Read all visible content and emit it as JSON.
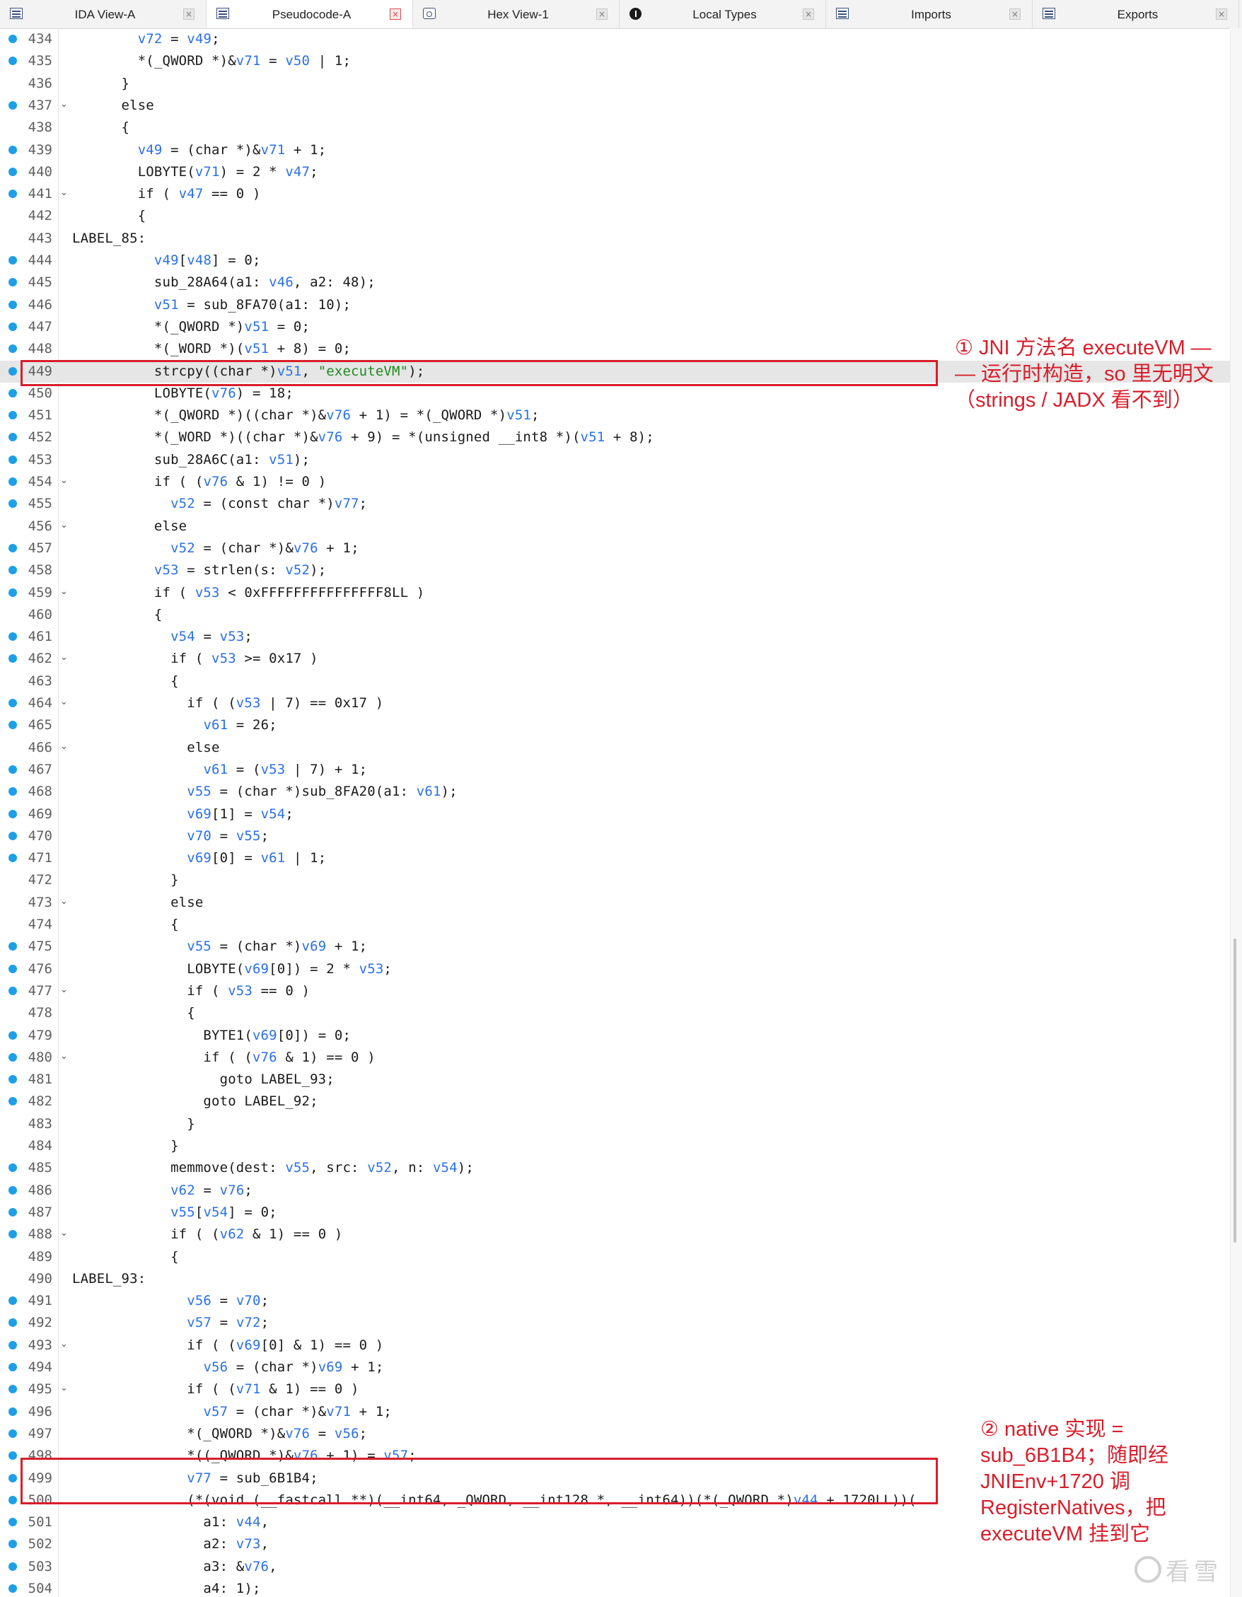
{
  "tabs": [
    {
      "label": "IDA View-A",
      "icon": "listing-icon",
      "close_style": "normal"
    },
    {
      "label": "Pseudocode-A",
      "icon": "pseudocode-icon",
      "close_style": "red",
      "active": true
    },
    {
      "label": "Hex View-1",
      "icon": "hex-view-icon",
      "close_style": "normal"
    },
    {
      "label": "Local Types",
      "icon": "local-types-icon",
      "close_style": "normal"
    },
    {
      "label": "Imports",
      "icon": "imports-icon",
      "close_style": "normal"
    },
    {
      "label": "Exports",
      "icon": "exports-icon",
      "close_style": "normal"
    }
  ],
  "close_glyph": "×",
  "code_lines": [
    {
      "n": 434,
      "bp": true,
      "fold": false,
      "t": [
        [
          "        "
        ],
        [
          "v72",
          "v"
        ],
        [
          " = "
        ],
        [
          "v49",
          "v"
        ],
        [
          ";"
        ]
      ]
    },
    {
      "n": 435,
      "bp": true,
      "fold": false,
      "t": [
        [
          "        *(_QWORD *)&"
        ],
        [
          "v71",
          "v"
        ],
        [
          " = "
        ],
        [
          "v50",
          "v"
        ],
        [
          " | 1;"
        ]
      ]
    },
    {
      "n": 436,
      "bp": false,
      "fold": false,
      "t": [
        [
          "      }"
        ]
      ]
    },
    {
      "n": 437,
      "bp": true,
      "fold": true,
      "t": [
        [
          "      else"
        ]
      ]
    },
    {
      "n": 438,
      "bp": false,
      "fold": false,
      "t": [
        [
          "      {"
        ]
      ]
    },
    {
      "n": 439,
      "bp": true,
      "fold": false,
      "t": [
        [
          "        "
        ],
        [
          "v49",
          "v"
        ],
        [
          " = (char *)&"
        ],
        [
          "v71",
          "v"
        ],
        [
          " + 1;"
        ]
      ]
    },
    {
      "n": 440,
      "bp": true,
      "fold": false,
      "t": [
        [
          "        LOBYTE("
        ],
        [
          "v71",
          "v"
        ],
        [
          ") = 2 * "
        ],
        [
          "v47",
          "v"
        ],
        [
          ";"
        ]
      ]
    },
    {
      "n": 441,
      "bp": true,
      "fold": true,
      "t": [
        [
          "        if ( "
        ],
        [
          "v47",
          "v"
        ],
        [
          " == 0 )"
        ]
      ]
    },
    {
      "n": 442,
      "bp": false,
      "fold": false,
      "t": [
        [
          "        {"
        ]
      ]
    },
    {
      "n": 443,
      "bp": false,
      "fold": false,
      "t": [
        [
          "LABEL_85:"
        ]
      ]
    },
    {
      "n": 444,
      "bp": true,
      "fold": false,
      "t": [
        [
          "          "
        ],
        [
          "v49",
          "v"
        ],
        [
          "["
        ],
        [
          "v48",
          "v"
        ],
        [
          "] = 0;"
        ]
      ]
    },
    {
      "n": 445,
      "bp": true,
      "fold": false,
      "t": [
        [
          "          sub_28A64(a1: "
        ],
        [
          "v46",
          "v"
        ],
        [
          ", a2: 48);"
        ]
      ]
    },
    {
      "n": 446,
      "bp": true,
      "fold": false,
      "t": [
        [
          "          "
        ],
        [
          "v51",
          "v"
        ],
        [
          " = sub_8FA70(a1: 10);"
        ]
      ]
    },
    {
      "n": 447,
      "bp": true,
      "fold": false,
      "t": [
        [
          "          *(_QWORD *)"
        ],
        [
          "v51",
          "v"
        ],
        [
          " = 0;"
        ]
      ]
    },
    {
      "n": 448,
      "bp": true,
      "fold": false,
      "t": [
        [
          "          *(_WORD *)("
        ],
        [
          "v51",
          "v"
        ],
        [
          " + 8) = 0;"
        ]
      ]
    },
    {
      "n": 449,
      "bp": true,
      "fold": false,
      "hl": true,
      "t": [
        [
          "          strcpy((char *)"
        ],
        [
          "v51",
          "v"
        ],
        [
          ", "
        ],
        [
          "\"executeVM\"",
          "s"
        ],
        [
          ");"
        ]
      ]
    },
    {
      "n": 450,
      "bp": true,
      "fold": false,
      "t": [
        [
          "          LOBYTE("
        ],
        [
          "v76",
          "v"
        ],
        [
          ") = 18;"
        ]
      ]
    },
    {
      "n": 451,
      "bp": true,
      "fold": false,
      "t": [
        [
          "          *(_QWORD *)((char *)&"
        ],
        [
          "v76",
          "v"
        ],
        [
          " + 1) = *(_QWORD *)"
        ],
        [
          "v51",
          "v"
        ],
        [
          ";"
        ]
      ]
    },
    {
      "n": 452,
      "bp": true,
      "fold": false,
      "t": [
        [
          "          *(_WORD *)((char *)&"
        ],
        [
          "v76",
          "v"
        ],
        [
          " + 9) = *(unsigned __int8 *)("
        ],
        [
          "v51",
          "v"
        ],
        [
          " + 8);"
        ]
      ]
    },
    {
      "n": 453,
      "bp": true,
      "fold": false,
      "t": [
        [
          "          sub_28A6C(a1: "
        ],
        [
          "v51",
          "v"
        ],
        [
          ");"
        ]
      ]
    },
    {
      "n": 454,
      "bp": true,
      "fold": true,
      "t": [
        [
          "          if ( ("
        ],
        [
          "v76",
          "v"
        ],
        [
          " & 1) != 0 )"
        ]
      ]
    },
    {
      "n": 455,
      "bp": true,
      "fold": false,
      "t": [
        [
          "            "
        ],
        [
          "v52",
          "v"
        ],
        [
          " = (const char *)"
        ],
        [
          "v77",
          "v"
        ],
        [
          ";"
        ]
      ]
    },
    {
      "n": 456,
      "bp": false,
      "fold": true,
      "t": [
        [
          "          else"
        ]
      ]
    },
    {
      "n": 457,
      "bp": true,
      "fold": false,
      "t": [
        [
          "            "
        ],
        [
          "v52",
          "v"
        ],
        [
          " = (char *)&"
        ],
        [
          "v76",
          "v"
        ],
        [
          " + 1;"
        ]
      ]
    },
    {
      "n": 458,
      "bp": true,
      "fold": false,
      "t": [
        [
          "          "
        ],
        [
          "v53",
          "v"
        ],
        [
          " = strlen(s: "
        ],
        [
          "v52",
          "v"
        ],
        [
          ");"
        ]
      ]
    },
    {
      "n": 459,
      "bp": true,
      "fold": true,
      "t": [
        [
          "          if ( "
        ],
        [
          "v53",
          "v"
        ],
        [
          " < 0xFFFFFFFFFFFFFFF8LL )"
        ]
      ]
    },
    {
      "n": 460,
      "bp": false,
      "fold": false,
      "t": [
        [
          "          {"
        ]
      ]
    },
    {
      "n": 461,
      "bp": true,
      "fold": false,
      "t": [
        [
          "            "
        ],
        [
          "v54",
          "v"
        ],
        [
          " = "
        ],
        [
          "v53",
          "v"
        ],
        [
          ";"
        ]
      ]
    },
    {
      "n": 462,
      "bp": true,
      "fold": true,
      "t": [
        [
          "            if ( "
        ],
        [
          "v53",
          "v"
        ],
        [
          " >= 0x17 )"
        ]
      ]
    },
    {
      "n": 463,
      "bp": false,
      "fold": false,
      "t": [
        [
          "            {"
        ]
      ]
    },
    {
      "n": 464,
      "bp": true,
      "fold": true,
      "t": [
        [
          "              if ( ("
        ],
        [
          "v53",
          "v"
        ],
        [
          " | 7) == 0x17 )"
        ]
      ]
    },
    {
      "n": 465,
      "bp": true,
      "fold": false,
      "t": [
        [
          "                "
        ],
        [
          "v61",
          "v"
        ],
        [
          " = 26;"
        ]
      ]
    },
    {
      "n": 466,
      "bp": false,
      "fold": true,
      "t": [
        [
          "              else"
        ]
      ]
    },
    {
      "n": 467,
      "bp": true,
      "fold": false,
      "t": [
        [
          "                "
        ],
        [
          "v61",
          "v"
        ],
        [
          " = ("
        ],
        [
          "v53",
          "v"
        ],
        [
          " | 7) + 1;"
        ]
      ]
    },
    {
      "n": 468,
      "bp": true,
      "fold": false,
      "t": [
        [
          "              "
        ],
        [
          "v55",
          "v"
        ],
        [
          " = (char *)sub_8FA20(a1: "
        ],
        [
          "v61",
          "v"
        ],
        [
          ");"
        ]
      ]
    },
    {
      "n": 469,
      "bp": true,
      "fold": false,
      "t": [
        [
          "              "
        ],
        [
          "v69",
          "v"
        ],
        [
          "[1] = "
        ],
        [
          "v54",
          "v"
        ],
        [
          ";"
        ]
      ]
    },
    {
      "n": 470,
      "bp": true,
      "fold": false,
      "t": [
        [
          "              "
        ],
        [
          "v70",
          "v"
        ],
        [
          " = "
        ],
        [
          "v55",
          "v"
        ],
        [
          ";"
        ]
      ]
    },
    {
      "n": 471,
      "bp": true,
      "fold": false,
      "t": [
        [
          "              "
        ],
        [
          "v69",
          "v"
        ],
        [
          "[0] = "
        ],
        [
          "v61",
          "v"
        ],
        [
          " | 1;"
        ]
      ]
    },
    {
      "n": 472,
      "bp": false,
      "fold": false,
      "t": [
        [
          "            }"
        ]
      ]
    },
    {
      "n": 473,
      "bp": false,
      "fold": true,
      "t": [
        [
          "            else"
        ]
      ]
    },
    {
      "n": 474,
      "bp": false,
      "fold": false,
      "t": [
        [
          "            {"
        ]
      ]
    },
    {
      "n": 475,
      "bp": true,
      "fold": false,
      "t": [
        [
          "              "
        ],
        [
          "v55",
          "v"
        ],
        [
          " = (char *)"
        ],
        [
          "v69",
          "v"
        ],
        [
          " + 1;"
        ]
      ]
    },
    {
      "n": 476,
      "bp": true,
      "fold": false,
      "t": [
        [
          "              LOBYTE("
        ],
        [
          "v69",
          "v"
        ],
        [
          "[0]) = 2 * "
        ],
        [
          "v53",
          "v"
        ],
        [
          ";"
        ]
      ]
    },
    {
      "n": 477,
      "bp": true,
      "fold": true,
      "t": [
        [
          "              if ( "
        ],
        [
          "v53",
          "v"
        ],
        [
          " == 0 )"
        ]
      ]
    },
    {
      "n": 478,
      "bp": false,
      "fold": false,
      "t": [
        [
          "              {"
        ]
      ]
    },
    {
      "n": 479,
      "bp": true,
      "fold": false,
      "t": [
        [
          "                BYTE1("
        ],
        [
          "v69",
          "v"
        ],
        [
          "[0]) = 0;"
        ]
      ]
    },
    {
      "n": 480,
      "bp": true,
      "fold": true,
      "t": [
        [
          "                if ( ("
        ],
        [
          "v76",
          "v"
        ],
        [
          " & 1) == 0 )"
        ]
      ]
    },
    {
      "n": 481,
      "bp": true,
      "fold": false,
      "t": [
        [
          "                  goto LABEL_93;"
        ]
      ]
    },
    {
      "n": 482,
      "bp": true,
      "fold": false,
      "t": [
        [
          "                goto LABEL_92;"
        ]
      ]
    },
    {
      "n": 483,
      "bp": false,
      "fold": false,
      "t": [
        [
          "              }"
        ]
      ]
    },
    {
      "n": 484,
      "bp": false,
      "fold": false,
      "t": [
        [
          "            }"
        ]
      ]
    },
    {
      "n": 485,
      "bp": true,
      "fold": false,
      "t": [
        [
          "            memmove(dest: "
        ],
        [
          "v55",
          "v"
        ],
        [
          ", src: "
        ],
        [
          "v52",
          "v"
        ],
        [
          ", n: "
        ],
        [
          "v54",
          "v"
        ],
        [
          ");"
        ]
      ]
    },
    {
      "n": 486,
      "bp": true,
      "fold": false,
      "t": [
        [
          "            "
        ],
        [
          "v62",
          "v"
        ],
        [
          " = "
        ],
        [
          "v76",
          "v"
        ],
        [
          ";"
        ]
      ]
    },
    {
      "n": 487,
      "bp": true,
      "fold": false,
      "t": [
        [
          "            "
        ],
        [
          "v55",
          "v"
        ],
        [
          "["
        ],
        [
          "v54",
          "v"
        ],
        [
          "] = 0;"
        ]
      ]
    },
    {
      "n": 488,
      "bp": true,
      "fold": true,
      "t": [
        [
          "            if ( ("
        ],
        [
          "v62",
          "v"
        ],
        [
          " & 1) == 0 )"
        ]
      ]
    },
    {
      "n": 489,
      "bp": false,
      "fold": false,
      "t": [
        [
          "            {"
        ]
      ]
    },
    {
      "n": 490,
      "bp": false,
      "fold": false,
      "t": [
        [
          "LABEL_93:"
        ]
      ]
    },
    {
      "n": 491,
      "bp": true,
      "fold": false,
      "t": [
        [
          "              "
        ],
        [
          "v56",
          "v"
        ],
        [
          " = "
        ],
        [
          "v70",
          "v"
        ],
        [
          ";"
        ]
      ]
    },
    {
      "n": 492,
      "bp": true,
      "fold": false,
      "t": [
        [
          "              "
        ],
        [
          "v57",
          "v"
        ],
        [
          " = "
        ],
        [
          "v72",
          "v"
        ],
        [
          ";"
        ]
      ]
    },
    {
      "n": 493,
      "bp": true,
      "fold": true,
      "t": [
        [
          "              if ( ("
        ],
        [
          "v69",
          "v"
        ],
        [
          "[0] & 1) == 0 )"
        ]
      ]
    },
    {
      "n": 494,
      "bp": true,
      "fold": false,
      "t": [
        [
          "                "
        ],
        [
          "v56",
          "v"
        ],
        [
          " = (char *)"
        ],
        [
          "v69",
          "v"
        ],
        [
          " + 1;"
        ]
      ]
    },
    {
      "n": 495,
      "bp": true,
      "fold": true,
      "t": [
        [
          "              if ( ("
        ],
        [
          "v71",
          "v"
        ],
        [
          " & 1) == 0 )"
        ]
      ]
    },
    {
      "n": 496,
      "bp": true,
      "fold": false,
      "t": [
        [
          "                "
        ],
        [
          "v57",
          "v"
        ],
        [
          " = (char *)&"
        ],
        [
          "v71",
          "v"
        ],
        [
          " + 1;"
        ]
      ]
    },
    {
      "n": 497,
      "bp": true,
      "fold": false,
      "t": [
        [
          "              *(_QWORD *)&"
        ],
        [
          "v76",
          "v"
        ],
        [
          " = "
        ],
        [
          "v56",
          "v"
        ],
        [
          ";"
        ]
      ]
    },
    {
      "n": 498,
      "bp": true,
      "fold": false,
      "t": [
        [
          "              *((_QWORD *)&"
        ],
        [
          "v76",
          "v"
        ],
        [
          " + 1) = "
        ],
        [
          "v57",
          "v"
        ],
        [
          ";"
        ]
      ]
    },
    {
      "n": 499,
      "bp": true,
      "fold": false,
      "t": [
        [
          "              "
        ],
        [
          "v77",
          "v"
        ],
        [
          " = sub_6B1B4;"
        ]
      ]
    },
    {
      "n": 500,
      "bp": true,
      "fold": false,
      "t": [
        [
          "              (*(void (__fastcall **)(__int64, _QWORD, __int128 *, __int64))(*(_QWORD *)"
        ],
        [
          "v44",
          "v"
        ],
        [
          " + 1720LL))("
        ]
      ]
    },
    {
      "n": 501,
      "bp": true,
      "fold": false,
      "t": [
        [
          "                a1: "
        ],
        [
          "v44",
          "v"
        ],
        [
          ","
        ]
      ]
    },
    {
      "n": 502,
      "bp": true,
      "fold": false,
      "t": [
        [
          "                a2: "
        ],
        [
          "v73",
          "v"
        ],
        [
          ","
        ]
      ]
    },
    {
      "n": 503,
      "bp": true,
      "fold": false,
      "t": [
        [
          "                a3: &"
        ],
        [
          "v76",
          "v"
        ],
        [
          ","
        ]
      ]
    },
    {
      "n": 504,
      "bp": true,
      "fold": false,
      "t": [
        [
          "                a4: 1);"
        ]
      ]
    }
  ],
  "annotations": {
    "note1": "① JNI 方法名 executeVM —\n— 运行时构造，so 里无明文\n（strings / JADX 看不到）",
    "note2": "② native 实现 =\nsub_6B1B4；随即经\nJNIEnv+1720 调\nRegisterNatives，把\nexecuteVM 挂到它"
  },
  "watermark": "看雪",
  "colors": {
    "annotation_red": "#d81e2b",
    "variable_blue": "#2a6fe8",
    "string_green": "#1e8a1e",
    "breakpoint_blue": "#1e9fe6",
    "highlight_line": "#e6e6e6"
  },
  "scroll_position": 0.72
}
